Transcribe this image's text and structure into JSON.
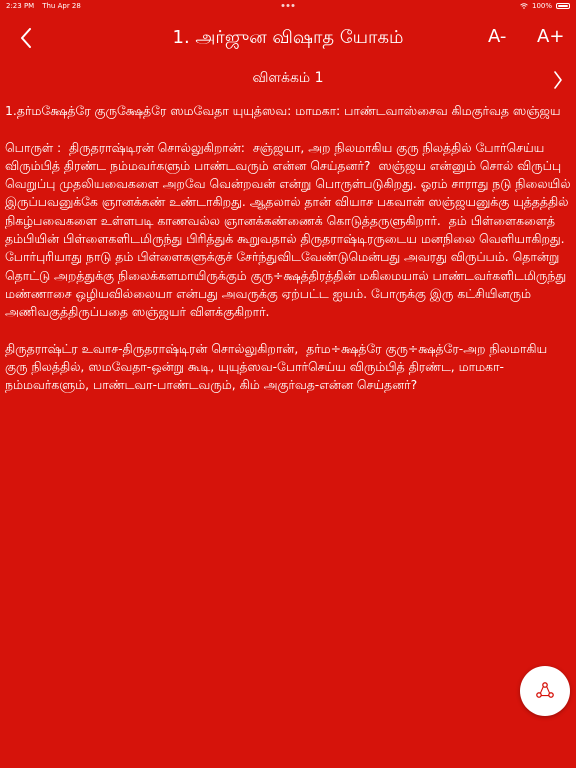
{
  "status_bar": {
    "time": "2:23 PM",
    "date": "Thu Apr 28",
    "battery": "100%",
    "wifi_icon": "wifi-icon",
    "battery_icon": "battery-icon"
  },
  "nav": {
    "title": "1. அர்ஜுன விஷாத யோகம்",
    "back_icon": "chevron-left-icon",
    "font_decrease_label": "A-",
    "font_increase_label": "A+"
  },
  "section": {
    "title": "விளக்கம் 1",
    "next_icon": "chevron-right-icon"
  },
  "content": {
    "verse": "1.தர்மக்ஷேத்ரே குருக்ஷேத்ரே ஸமவேதா யுயுத்ஸவ: மாமகா: பாண்டவாஸ்சைவ கிமகுர்வத ஸஞ்ஜய",
    "meaning": "பொருள் :  திருதராஷ்டிரன் சொல்லுகிறான்:  சஞ்ஜயா, அற நிலமாகிய குரு நிலத்தில் போர்செய்ய விரும்பித் திரண்ட நம்மவர்களும் பாண்டவரும் என்ன செய்தனர்?  ஸஞ்ஜய என்னும் சொல் விருப்பு வெறுப்பு முதலியவைகளை அறவே வென்றவன் என்று பொருள்படுகிறது. ஓரம் சாராது நடு நிலையில் இருப்பவனுக்கே ஞானக்கண் உண்டாகிறது. ஆதலால் தான் வியாச பகவான் ஸஞ்ஜயனுக்கு யுத்தத்தில் நிகழ்பவைகளை உள்ளபடி காணவல்ல ஞானக்கண்ணைக் கொடுத்தருளுகிறார்.  தம் பிள்ளைகளைத் தம்பியின் பிள்ளைகளிடமிருந்து பிரித்துக் கூறுவதால் திருதராஷ்டிரருடைய மனநிலை வெளியாகிறது. போர்புரியாது நாடு தம் பிள்ளைகளுக்குச் சேர்ந்துவிடவேண்டுமென்பது அவரது விருப்பம். தொன்று தொட்டு அறத்துக்கு நிலைக்களமாயிருக்கும் குரு÷க்ஷத்திரத்தின் மகிமையால் பாண்டவர்களிடமிருந்து மண்ணாசை ஒழியவில்லையா என்பது அவருக்கு ஏற்பட்ட ஐயம். போருக்கு இரு கட்சியினரும் அணிவகுத்திருப்பதை ஸஞ்ஜயர் விளக்குகிறார்.",
    "word_meaning": "திருதராஷ்ட்ர உவாச-திருதராஷ்டிரன் சொல்லுகிறான்,  தர்ம÷க்ஷத்ரே குரு÷க்ஷத்ரே-அற நிலமாகிய குரு நிலத்தில், ஸமவேதா-ஒன்று கூடி, யுயுத்ஸவ-போர்செய்ய விரும்பித் திரண்ட, மாமகா-நம்மவர்களும், பாண்டவா-பாண்டவரும், கிம் அகுர்வத-என்ன செய்தனர்?"
  },
  "fab": {
    "icon": "share-icon"
  },
  "colors": {
    "background": "#d6130b",
    "text": "#ffffff",
    "fab_background": "#ffffff",
    "fab_icon": "#d6130b"
  }
}
